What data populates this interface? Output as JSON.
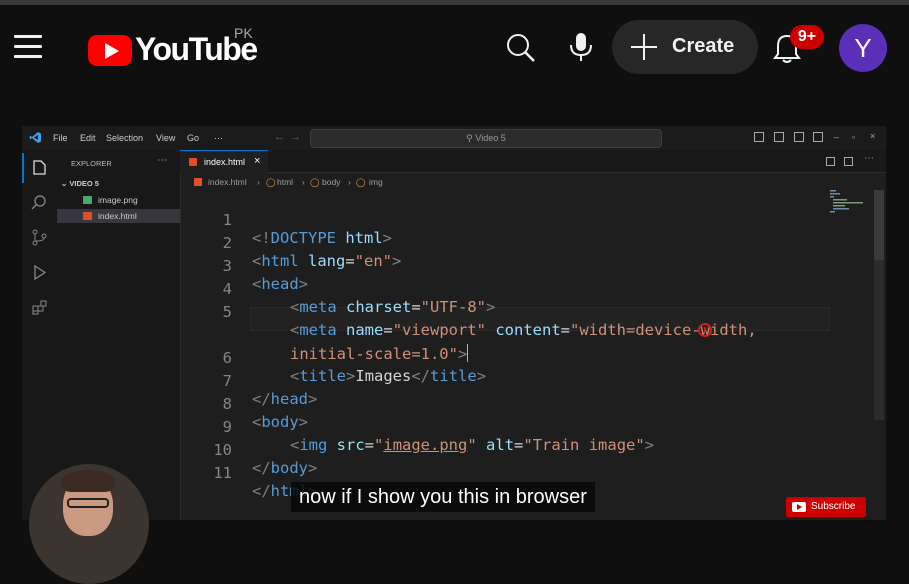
{
  "youtube": {
    "logo_text": "YouTube",
    "country": "PK",
    "create_label": "Create",
    "notifications_badge": "9+",
    "avatar_initial": "Y",
    "icons": [
      "menu-icon",
      "search-icon",
      "mic-icon",
      "plus-icon",
      "bell-icon"
    ]
  },
  "vscode": {
    "menu": [
      "File",
      "Edit",
      "Selection",
      "View",
      "Go",
      "⋯"
    ],
    "search_text": "Video 5",
    "explorer_title": "EXPLORER",
    "explorer_dots": "⋯",
    "folder": "VIDEO 5",
    "files": [
      "image.png",
      "index.html"
    ],
    "tab_label": "index.html",
    "tab_close": "×",
    "breadcrumb": [
      "index.html",
      "html",
      "body",
      "img"
    ],
    "lines": [
      {
        "n": "1"
      },
      {
        "n": "2"
      },
      {
        "n": "3"
      },
      {
        "n": "4"
      },
      {
        "n": "5"
      },
      {
        "n": ""
      },
      {
        "n": "6"
      },
      {
        "n": "7"
      },
      {
        "n": "8"
      },
      {
        "n": "9"
      },
      {
        "n": "10"
      },
      {
        "n": "11"
      }
    ],
    "code": {
      "l1": {
        "a": "<!",
        "b": "DOCTYPE",
        "c": " html",
        "d": ">"
      },
      "l2": {
        "a": "<",
        "b": "html",
        "c": " lang",
        "d": "=",
        "e": "\"en\"",
        "f": ">"
      },
      "l3": {
        "a": "<",
        "b": "head",
        "c": ">"
      },
      "l4": {
        "a": "<",
        "b": "meta",
        "c": " charset",
        "d": "=",
        "e": "\"UTF-8\"",
        "f": ">"
      },
      "l5": {
        "a": "<",
        "b": "meta",
        "c": " name",
        "d": "=",
        "e": "\"viewport\"",
        "f": " content",
        "g": "=",
        "h": "\"width=device-width,"
      },
      "l5b": {
        "a": "initial-scale=1.0\"",
        "b": ">"
      },
      "l6": {
        "a": "<",
        "b": "title",
        "c": ">",
        "d": "Images",
        "e": "</",
        "f": "title",
        "g": ">"
      },
      "l7": {
        "a": "</",
        "b": "head",
        "c": ">"
      },
      "l8": {
        "a": "<",
        "b": "body",
        "c": ">"
      },
      "l9": {
        "a": "<",
        "b": "img",
        "c": " src",
        "d": "=",
        "e": "\"",
        "f": "image.png",
        "g": "\"",
        "h": " alt",
        "i": "=",
        "j": "\"Train image\"",
        "k": ">"
      },
      "l10": {
        "a": "</",
        "b": "body",
        "c": ">"
      },
      "l11": {
        "a": "</",
        "b": "html",
        "c": ">"
      }
    }
  },
  "caption": "now if I show you this in browser",
  "subscribe_label": "Subscribe",
  "colors": {
    "tag": "#569cd6",
    "attr": "#9cdcfe",
    "string": "#ce9178",
    "brand_red": "#ff0000",
    "avatar": "#5b2fb8"
  }
}
